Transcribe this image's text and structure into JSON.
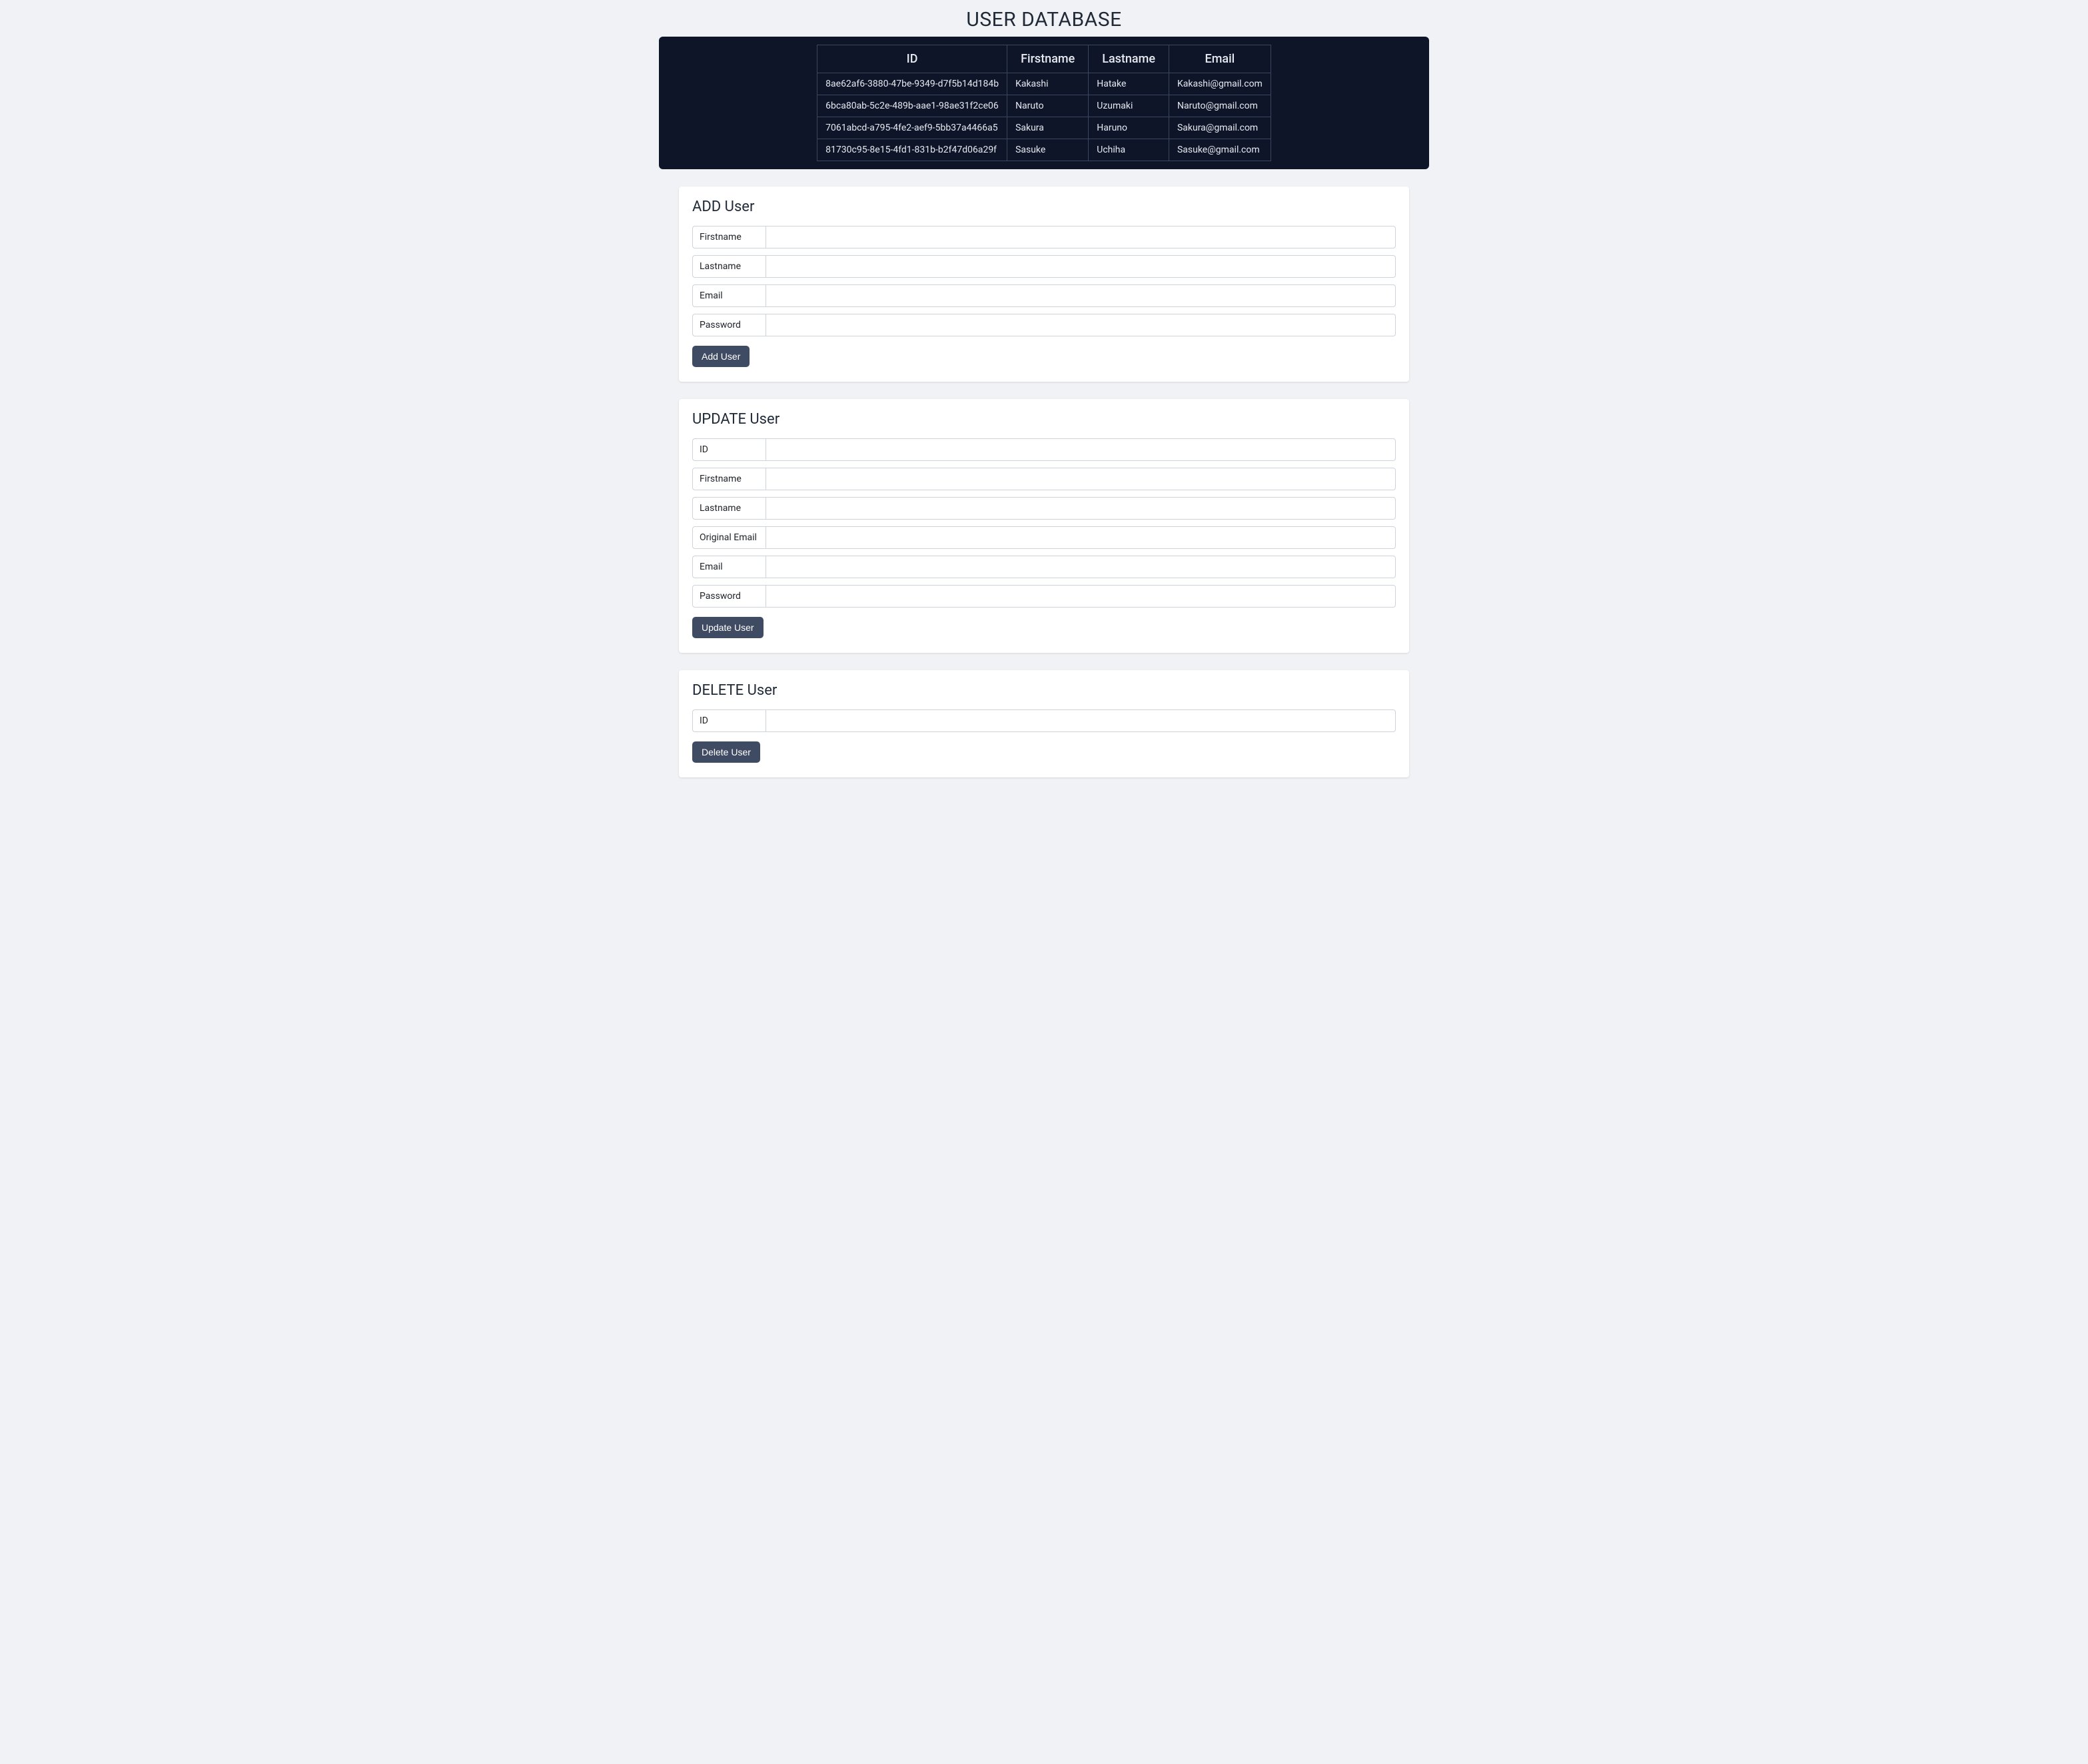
{
  "page": {
    "title": "USER DATABASE"
  },
  "table": {
    "headers": {
      "id": "ID",
      "firstname": "Firstname",
      "lastname": "Lastname",
      "email": "Email"
    },
    "rows": [
      {
        "id": "8ae62af6-3880-47be-9349-d7f5b14d184b",
        "firstname": "Kakashi",
        "lastname": "Hatake",
        "email": "Kakashi@gmail.com"
      },
      {
        "id": "6bca80ab-5c2e-489b-aae1-98ae31f2ce06",
        "firstname": "Naruto",
        "lastname": "Uzumaki",
        "email": "Naruto@gmail.com"
      },
      {
        "id": "7061abcd-a795-4fe2-aef9-5bb37a4466a5",
        "firstname": "Sakura",
        "lastname": "Haruno",
        "email": "Sakura@gmail.com"
      },
      {
        "id": "81730c95-8e15-4fd1-831b-b2f47d06a29f",
        "firstname": "Sasuke",
        "lastname": "Uchiha",
        "email": "Sasuke@gmail.com"
      }
    ]
  },
  "forms": {
    "add": {
      "title": "ADD User",
      "labels": {
        "firstname": "Firstname",
        "lastname": "Lastname",
        "email": "Email",
        "password": "Password"
      },
      "values": {
        "firstname": "",
        "lastname": "",
        "email": "",
        "password": ""
      },
      "button": "Add User"
    },
    "update": {
      "title": "UPDATE User",
      "labels": {
        "id": "ID",
        "firstname": "Firstname",
        "lastname": "Lastname",
        "original_email": "Original Email",
        "email": "Email",
        "password": "Password"
      },
      "values": {
        "id": "",
        "firstname": "",
        "lastname": "",
        "original_email": "",
        "email": "",
        "password": ""
      },
      "button": "Update User"
    },
    "delete": {
      "title": "DELETE User",
      "labels": {
        "id": "ID"
      },
      "values": {
        "id": ""
      },
      "button": "Delete User"
    }
  }
}
